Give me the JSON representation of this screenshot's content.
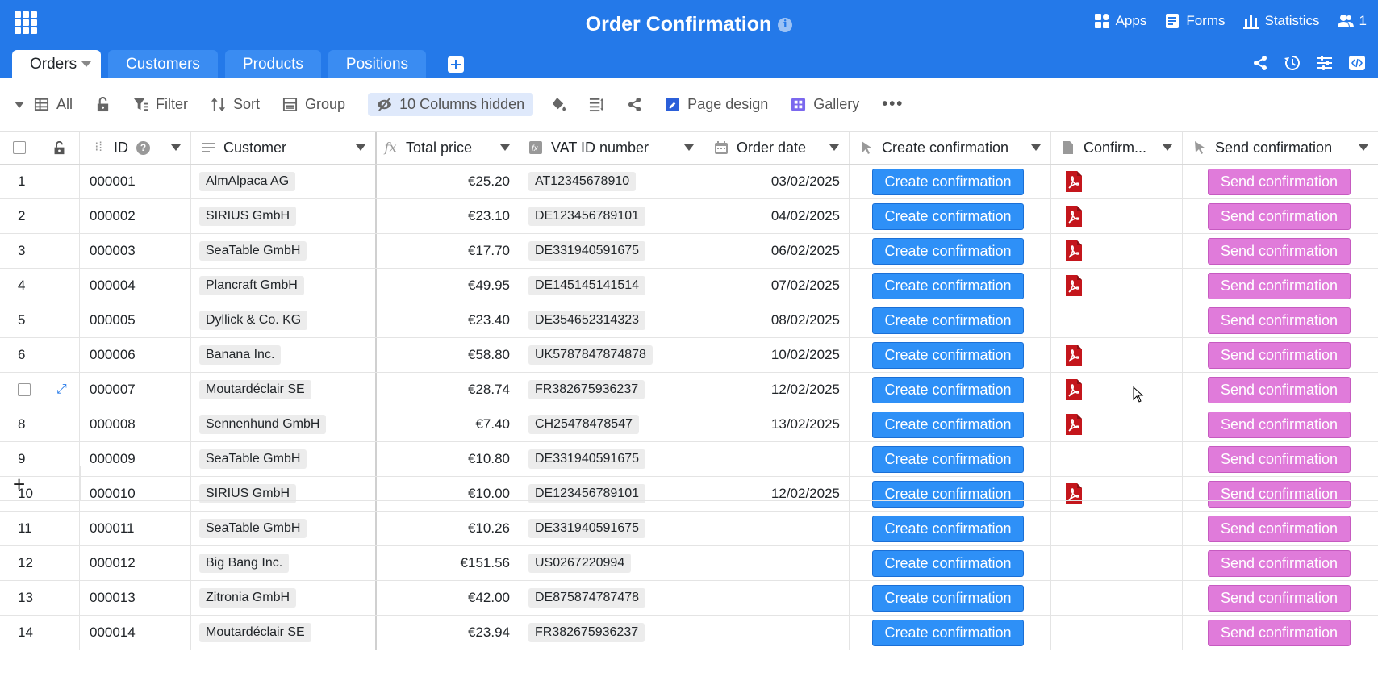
{
  "header": {
    "title": "Order Confirmation",
    "info_icon": "i",
    "right_items": [
      {
        "icon": "apps-icon",
        "label": "Apps"
      },
      {
        "icon": "forms-icon",
        "label": "Forms"
      },
      {
        "icon": "statistics-icon",
        "label": "Statistics"
      },
      {
        "icon": "collaborators-icon",
        "label": "1"
      }
    ]
  },
  "tabs": [
    {
      "label": "Orders",
      "active": true
    },
    {
      "label": "Customers"
    },
    {
      "label": "Products"
    },
    {
      "label": "Positions"
    }
  ],
  "toolbar": {
    "view": "All",
    "filter": "Filter",
    "sort": "Sort",
    "group": "Group",
    "hidden_columns": "10 Columns hidden",
    "page_design": "Page design",
    "gallery": "Gallery",
    "more": "•••"
  },
  "columns": [
    "ID",
    "Customer",
    "Total price",
    "VAT ID number",
    "Order date",
    "Create confirmation",
    "Confirm...",
    "Send confirmation"
  ],
  "rows": [
    {
      "n": "1",
      "id": "000001",
      "customer": "AlmAlpaca AG",
      "price": "€25.20",
      "vat": "AT12345678910",
      "date": "03/02/2025",
      "pdf": true
    },
    {
      "n": "2",
      "id": "000002",
      "customer": "SIRIUS GmbH",
      "price": "€23.10",
      "vat": "DE123456789101",
      "date": "04/02/2025",
      "pdf": true
    },
    {
      "n": "3",
      "id": "000003",
      "customer": "SeaTable GmbH",
      "price": "€17.70",
      "vat": "DE331940591675",
      "date": "06/02/2025",
      "pdf": true
    },
    {
      "n": "4",
      "id": "000004",
      "customer": "Plancraft GmbH",
      "price": "€49.95",
      "vat": "DE145145141514",
      "date": "07/02/2025",
      "pdf": true
    },
    {
      "n": "5",
      "id": "000005",
      "customer": "Dyllick & Co. KG",
      "price": "€23.40",
      "vat": "DE354652314323",
      "date": "08/02/2025",
      "pdf": false
    },
    {
      "n": "6",
      "id": "000006",
      "customer": "Banana Inc.",
      "price": "€58.80",
      "vat": "UK5787847874878",
      "date": "10/02/2025",
      "pdf": true
    },
    {
      "n": "",
      "id": "000007",
      "customer": "Moutardéclair SE",
      "price": "€28.74",
      "vat": "FR382675936237",
      "date": "12/02/2025",
      "pdf": true,
      "hover": true
    },
    {
      "n": "8",
      "id": "000008",
      "customer": "Sennenhund GmbH",
      "price": "€7.40",
      "vat": "CH25478478547",
      "date": "13/02/2025",
      "pdf": true
    },
    {
      "n": "9",
      "id": "000009",
      "customer": "SeaTable GmbH",
      "price": "€10.80",
      "vat": "DE331940591675",
      "date": "",
      "pdf": false
    },
    {
      "n": "10",
      "id": "000010",
      "customer": "SIRIUS GmbH",
      "price": "€10.00",
      "vat": "DE123456789101",
      "date": "12/02/2025",
      "pdf": true
    },
    {
      "n": "11",
      "id": "000011",
      "customer": "SeaTable GmbH",
      "price": "€10.26",
      "vat": "DE331940591675",
      "date": "",
      "pdf": false
    },
    {
      "n": "12",
      "id": "000012",
      "customer": "Big Bang Inc.",
      "price": "€151.56",
      "vat": "US0267220994",
      "date": "",
      "pdf": false
    },
    {
      "n": "13",
      "id": "000013",
      "customer": "Zitronia GmbH",
      "price": "€42.00",
      "vat": "DE875874787478",
      "date": "",
      "pdf": false
    },
    {
      "n": "14",
      "id": "000014",
      "customer": "Moutardéclair SE",
      "price": "€23.94",
      "vat": "FR382675936237",
      "date": "",
      "pdf": false
    }
  ],
  "buttons": {
    "create": "Create confirmation",
    "send": "Send confirmation"
  },
  "add_row": "+",
  "colors": {
    "header_bg": "#2479e9",
    "create_button": "#2e90f7",
    "send_button": "#e07bda",
    "pdf_icon": "#c4161c"
  }
}
